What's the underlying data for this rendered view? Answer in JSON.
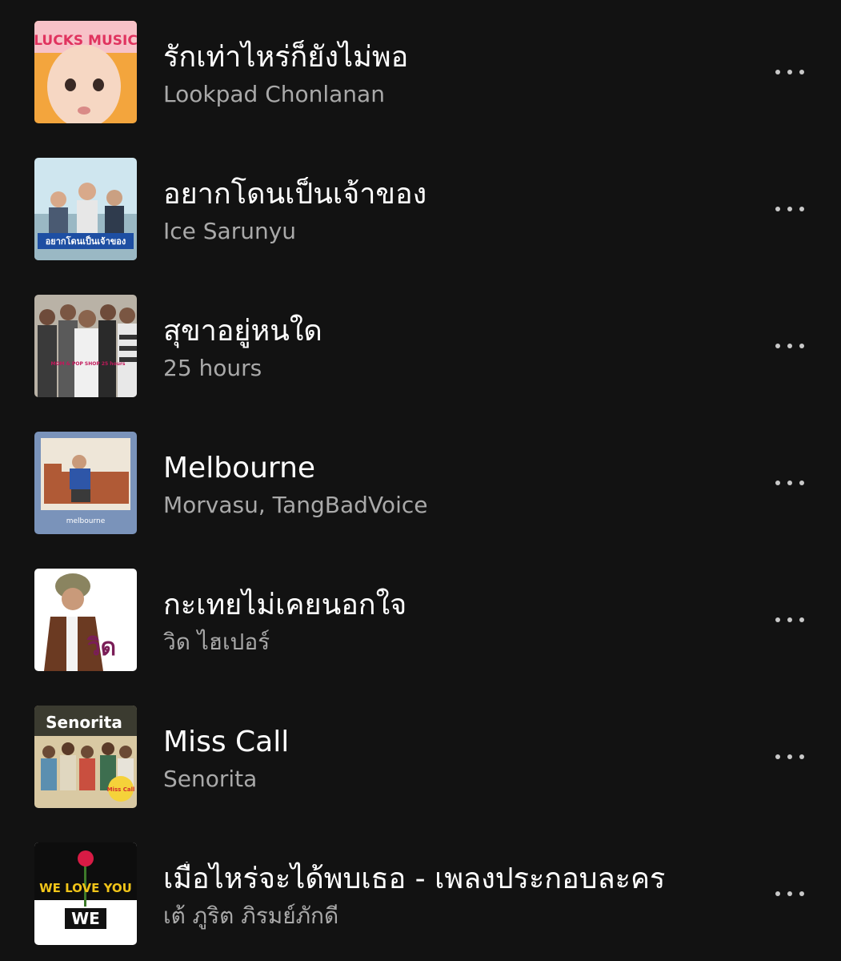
{
  "tracks": [
    {
      "title": "รักเท่าไหร่ก็ยังไม่พอ",
      "artist": "Lookpad Chonlanan",
      "cover_text": "LUCKS MUSIC",
      "cover_icon": "baby-face-album-art"
    },
    {
      "title": "อยากโดนเป็นเจ้าของ",
      "artist": "Ice Sarunyu",
      "cover_text": "อยากโดนเป็นเจ้าของ",
      "cover_icon": "group-photo-album-art"
    },
    {
      "title": "สุขาอยู่หนใด",
      "artist": "25 hours",
      "cover_text": "MOM & POP SHOP 25 hours",
      "cover_icon": "band-photo-album-art"
    },
    {
      "title": "Melbourne",
      "artist": "Morvasu, TangBadVoice",
      "cover_text": "melbourne",
      "cover_icon": "sofa-photo-album-art"
    },
    {
      "title": "กะเทยไม่เคยนอกใจ",
      "artist": "วิด ไฮเปอร์",
      "cover_text": "วิด",
      "cover_icon": "portrait-album-art"
    },
    {
      "title": "Miss Call",
      "artist": "Senorita",
      "cover_text": "Senorita",
      "cover_text_2": "Miss Call",
      "cover_icon": "girl-group-album-art"
    },
    {
      "title": "เมื่อไหร่จะได้พบเธอ - เพลงประกอบละคร",
      "artist": "เต้ ภูริต ภิรมย์ภักดี",
      "cover_text": "WE LOVE YOU",
      "cover_text_2": "WE",
      "cover_icon": "rose-album-art"
    }
  ],
  "colors": {
    "background": "#121212",
    "title": "#ffffff",
    "artist": "#a9a9a9",
    "more_dots": "#c8c8c8"
  },
  "more_icon": "more-options-icon"
}
